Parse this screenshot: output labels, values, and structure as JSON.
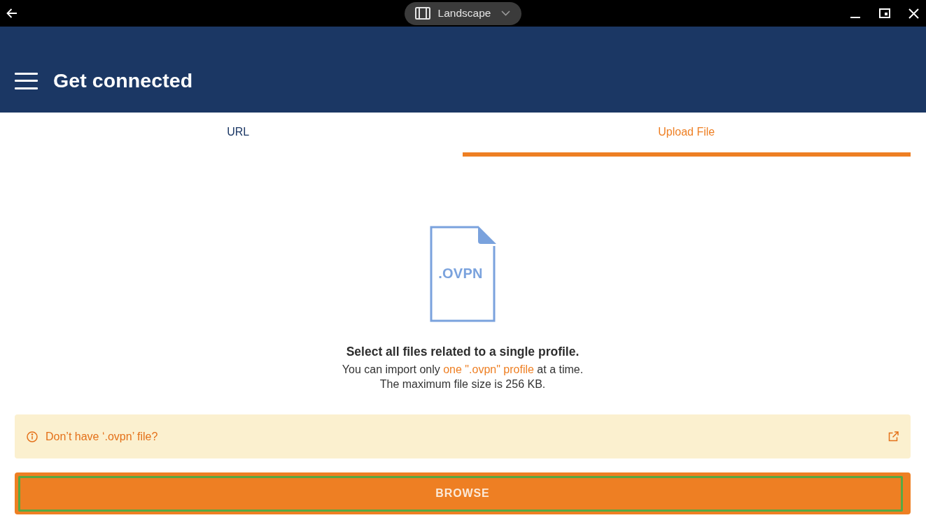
{
  "system_bar": {
    "orientation": "Landscape"
  },
  "app_bar": {
    "title": "Get connected"
  },
  "tabs": [
    {
      "label": "URL",
      "selected": false
    },
    {
      "label": "Upload File",
      "selected": true
    }
  ],
  "upload": {
    "file_type": ".OVPN",
    "heading": "Select all files related to a single profile.",
    "import_note": {
      "before": "You can import only",
      "link": "one \".ovpn\" profile",
      "after": "at a time."
    },
    "size_note": "The maximum file size is 256 KB."
  },
  "notice": {
    "text": "Don’t have ‘.ovpn’ file?"
  },
  "browse_button": {
    "label": "BROWSE",
    "focused": true
  }
}
